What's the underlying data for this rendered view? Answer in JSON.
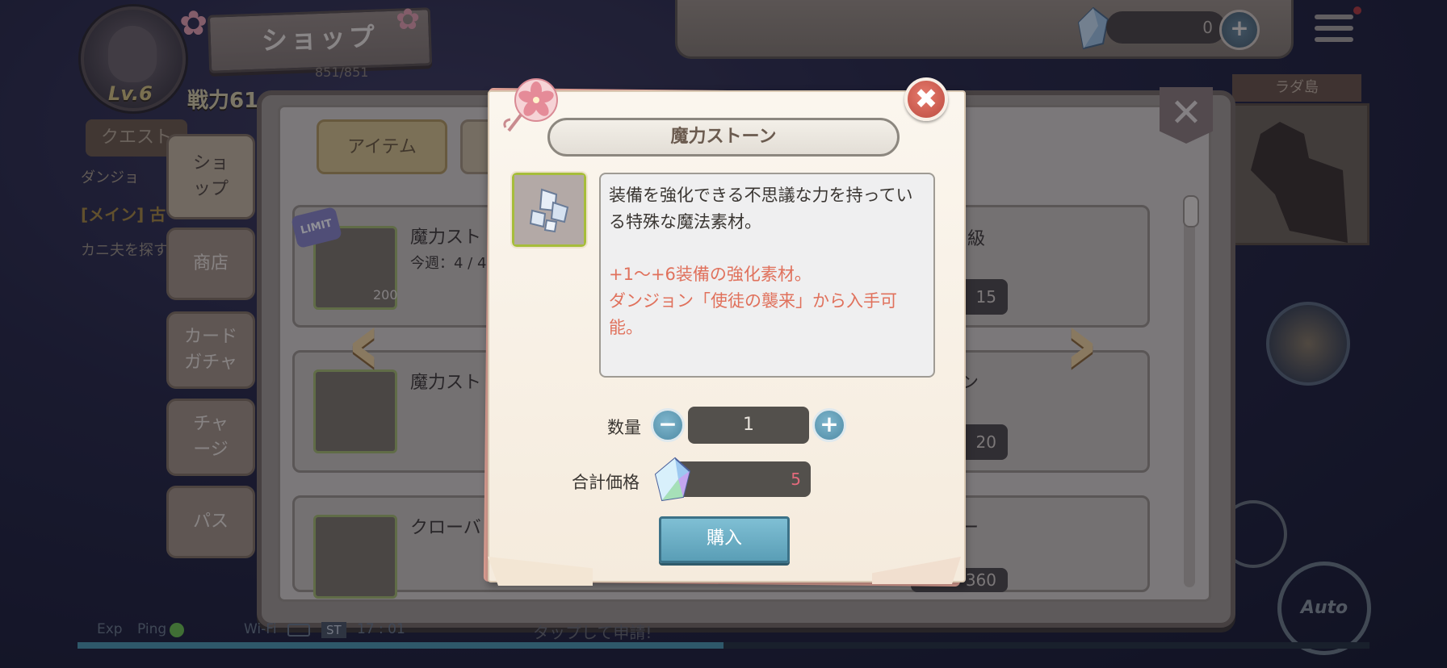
{
  "hud": {
    "level": "Lv.6",
    "power": "戦力61",
    "shop_title": "ショップ",
    "exp_numbers": "851/851",
    "quest_button": "クエスト",
    "dungeon_label": "ダンジョ",
    "main_quest": "[メイン] 古",
    "quest_desc": "カニ夫を探す",
    "currency_amount": "0",
    "island_name": "ラダ島",
    "auto_label": "Auto"
  },
  "shop": {
    "tabs": [
      {
        "label": "アイテム"
      }
    ],
    "side_tabs": [
      {
        "label": "ショ\nップ"
      },
      {
        "label": "商店"
      },
      {
        "label": "カード\nガチャ"
      },
      {
        "label": "チャ\nージ"
      },
      {
        "label": "パス"
      }
    ],
    "items": [
      {
        "name": "魔力スト",
        "weekly": "今週：4 / 4",
        "count": "200"
      },
      {
        "name": "魔力スト",
        "weekly": "",
        "count": ""
      },
      {
        "name": "クローバ",
        "weekly": "",
        "count": ""
      }
    ],
    "right_items": [
      {
        "name": "級",
        "price": "15"
      },
      {
        "name": "ン",
        "price": "20"
      },
      {
        "name": "ー",
        "price": "360"
      }
    ],
    "limit_badge": "LIMIT"
  },
  "status": {
    "exp": "Exp",
    "ping": "Ping",
    "wifi": "Wi-Fi",
    "st": "ST",
    "time": "17 : 01",
    "tap_hint": "タップして申請!",
    "exp_progress": 0.5
  },
  "modal": {
    "title": "魔力ストーン",
    "description": "装備を強化できる不思議な力を持っている特殊な魔法素材。",
    "note_line1": "+1～+6装備の強化素材。",
    "note_line2": "ダンジョン「使徒の襲来」から入手可能。",
    "quantity_label": "数量",
    "quantity_value": "1",
    "total_label": "合計価格",
    "total_value": "5",
    "buy_label": "購入",
    "minus": "−",
    "plus": "+",
    "close": "✖"
  },
  "colors": {
    "accent_blue": "#5a9eb6",
    "price_red": "#e46a7c",
    "note_red": "#e0715c",
    "close_red": "#c9574b"
  },
  "icons": [
    "gem-icon",
    "menu-icon",
    "close-icon",
    "plus-icon",
    "minus-icon",
    "sakura-pin-icon",
    "magic-stone-icon",
    "clover-icon",
    "chevron-left-icon",
    "chevron-right-icon"
  ]
}
